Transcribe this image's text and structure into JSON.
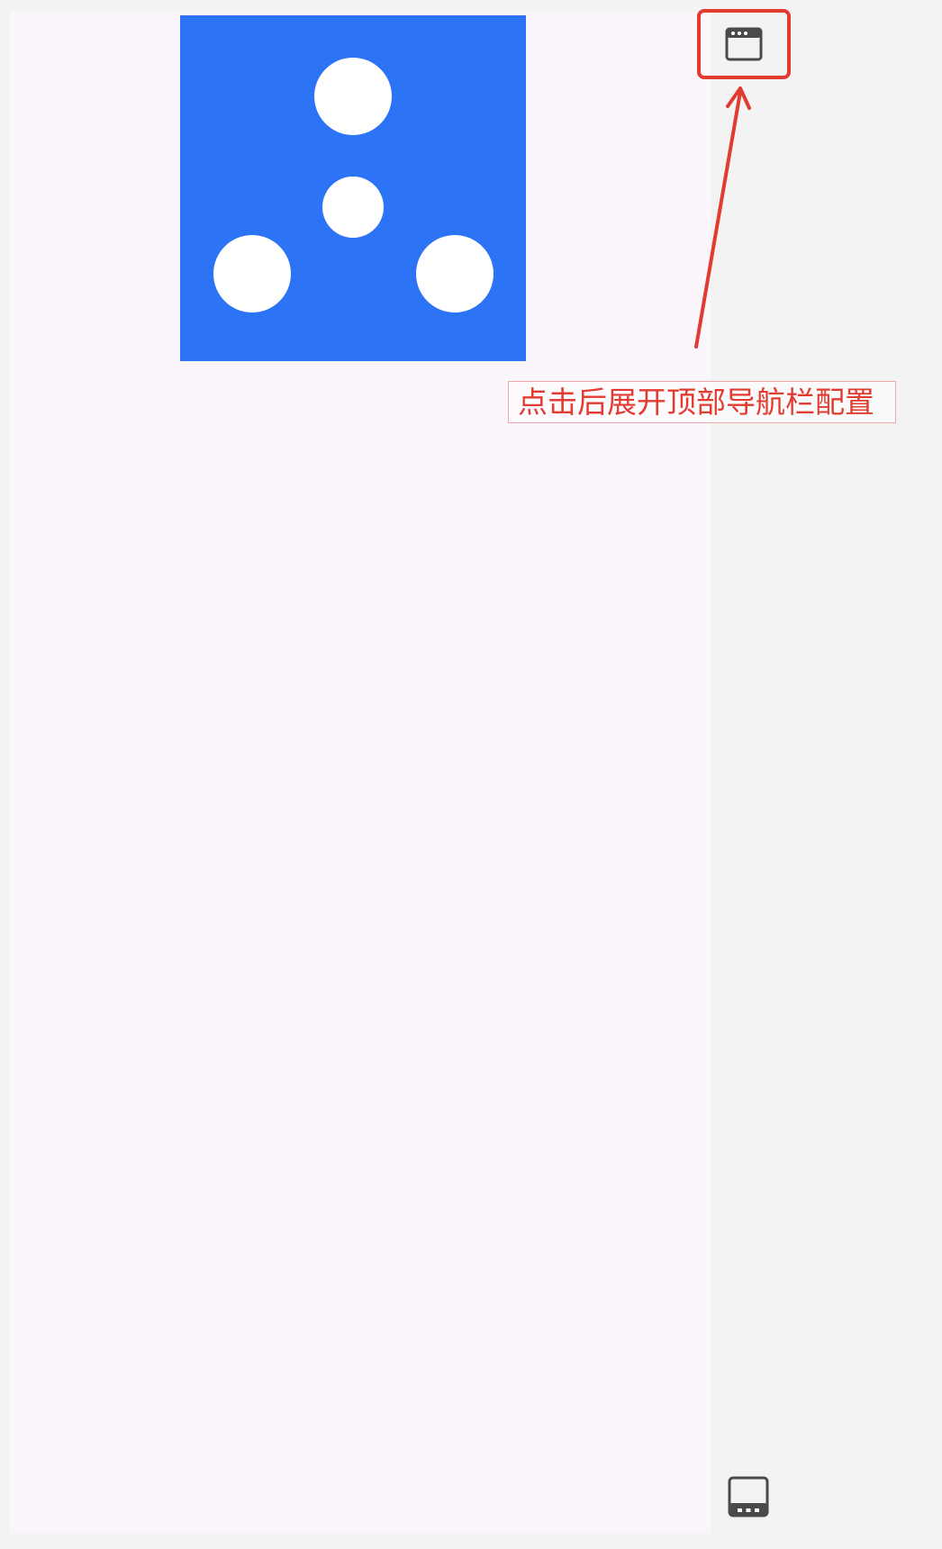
{
  "annotation": {
    "text": "点击后展开顶部导航栏配置"
  },
  "icons": {
    "logo": "blue-square-four-dots-logo",
    "top_nav": "window-top-bar-icon",
    "bottom_nav": "window-bottom-bar-icon"
  },
  "colors": {
    "logo_blue": "#2d73f6",
    "annotation_red": "#e23b30",
    "preview_background": "#faf6fb",
    "page_background": "#f3f3f3",
    "icon_gray": "#4a4a4a"
  }
}
